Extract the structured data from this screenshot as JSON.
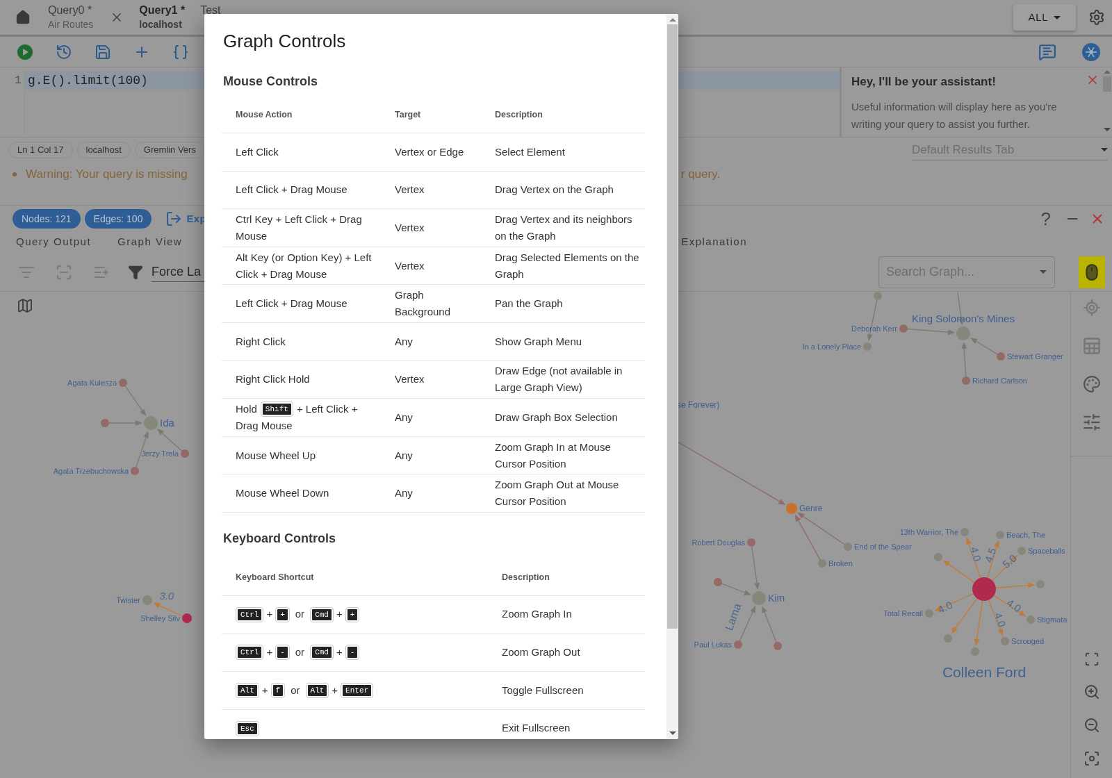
{
  "editor_tabs": [
    {
      "title": "Query0 *",
      "subtitle": "Air Routes",
      "selected": false
    },
    {
      "title": "Query1 *",
      "subtitle": "localhost",
      "selected": true
    },
    {
      "title": "Test",
      "selected": false
    }
  ],
  "scope_button": "ALL",
  "editor": {
    "line_number": "1",
    "code": "g.E().limit(100)"
  },
  "assistant": {
    "title": "Hey, I'll be your assistant!",
    "body": "Useful information will display here as you're writing your query to assist you further."
  },
  "status_chips": [
    "Ln 1 Col 17",
    "localhost",
    "Gremlin Vers"
  ],
  "results_tab_select": "Default Results Tab",
  "warning": {
    "left": "Warning: Your query is missing",
    "right": "r query."
  },
  "result_chips": [
    "Nodes: 121",
    "Edges: 100"
  ],
  "export_label": "Exp",
  "help_mark": "?",
  "result_tabs": [
    {
      "label": "Query Output",
      "selected": false
    },
    {
      "label": "Graph View",
      "selected": false
    },
    {
      "label": "Explanation",
      "selected": false
    }
  ],
  "layout_select": "Force La",
  "search_graph": {
    "placeholder": "Search Graph..."
  },
  "graph": {
    "node_labels": [
      "Agata Kulesza",
      "Ida",
      "Jerzy Trela",
      "Agata Trzebuchowska",
      "Twister",
      "Shelley Silv",
      "In a Lonely Place",
      "Deborah Kerr",
      "King Solomon's Mines",
      "Stewart Granger",
      "Richard Carlson",
      "se Forever)",
      "Genre",
      "Robert Douglas",
      "End of the Spear",
      "Broken",
      "Kim",
      "Paul Lukas",
      "13th Warrior, The",
      "Beach, The",
      "Spaceballs",
      "Colleen Ford",
      "Total Recall",
      "Stigmata",
      "Scrooged"
    ],
    "edge_labels": [
      "3.0",
      "Lama",
      "4.0",
      "4.5",
      "5.0",
      "4.0",
      "4.0",
      "4.0"
    ]
  },
  "dialog": {
    "title": "Graph Controls",
    "mouse_section": {
      "title": "Mouse Controls",
      "columns": [
        "Mouse Action",
        "Target",
        "Description"
      ],
      "rows": [
        {
          "action": [
            {
              "kind": "text",
              "text": "Left Click"
            }
          ],
          "target": "Vertex or Edge",
          "description": "Select Element"
        },
        {
          "action": [
            {
              "kind": "text",
              "text": "Left Click + Drag Mouse"
            }
          ],
          "target": "Vertex",
          "description": "Drag Vertex on the Graph"
        },
        {
          "action": [
            {
              "kind": "text",
              "text": "Ctrl Key + Left Click + Drag Mouse"
            }
          ],
          "target": "Vertex",
          "description": "Drag Vertex and its neighbors on the Graph"
        },
        {
          "action": [
            {
              "kind": "text",
              "text": "Alt Key (or Option Key) + Left Click + Drag Mouse"
            }
          ],
          "target": "Vertex",
          "description": "Drag Selected Elements on the Graph"
        },
        {
          "action": [
            {
              "kind": "text",
              "text": "Left Click + Drag Mouse"
            }
          ],
          "target": "Graph Background",
          "description": "Pan the Graph"
        },
        {
          "action": [
            {
              "kind": "text",
              "text": "Right Click"
            }
          ],
          "target": "Any",
          "description": "Show Graph Menu"
        },
        {
          "action": [
            {
              "kind": "text",
              "text": "Right Click Hold"
            }
          ],
          "target": "Vertex",
          "description": "Draw Edge (not available in Large Graph View)"
        },
        {
          "action": [
            {
              "kind": "text",
              "text": "Hold"
            },
            {
              "kind": "key",
              "text": "Shift"
            },
            {
              "kind": "text",
              "text": "+ Left Click +"
            },
            {
              "kind": "text",
              "text": "Drag Mouse"
            }
          ],
          "target": "Any",
          "description": "Draw Graph Box Selection"
        },
        {
          "action": [
            {
              "kind": "text",
              "text": "Mouse Wheel Up"
            }
          ],
          "target": "Any",
          "description": "Zoom Graph In at Mouse Cursor Position"
        },
        {
          "action": [
            {
              "kind": "text",
              "text": "Mouse Wheel Down"
            }
          ],
          "target": "Any",
          "description": "Zoom Graph Out at Mouse Cursor Position"
        }
      ]
    },
    "keyboard_section": {
      "title": "Keyboard Controls",
      "columns": [
        "Keyboard Shortcut",
        "Description"
      ],
      "rows": [
        {
          "shortcut": [
            {
              "kind": "key",
              "text": "Ctrl"
            },
            {
              "kind": "sep",
              "text": "+"
            },
            {
              "kind": "key",
              "text": "+"
            },
            {
              "kind": "sep",
              "text": "or"
            },
            {
              "kind": "key",
              "text": "Cmd"
            },
            {
              "kind": "sep",
              "text": "+"
            },
            {
              "kind": "key",
              "text": "+"
            }
          ],
          "description": "Zoom Graph In"
        },
        {
          "shortcut": [
            {
              "kind": "key",
              "text": "Ctrl"
            },
            {
              "kind": "sep",
              "text": "+"
            },
            {
              "kind": "key",
              "text": "-"
            },
            {
              "kind": "sep",
              "text": "or"
            },
            {
              "kind": "key",
              "text": "Cmd"
            },
            {
              "kind": "sep",
              "text": "+"
            },
            {
              "kind": "key",
              "text": "-"
            }
          ],
          "description": "Zoom Graph Out"
        },
        {
          "shortcut": [
            {
              "kind": "key",
              "text": "Alt"
            },
            {
              "kind": "sep",
              "text": "+"
            },
            {
              "kind": "key",
              "text": "f"
            },
            {
              "kind": "sep",
              "text": "or"
            },
            {
              "kind": "key",
              "text": "Alt"
            },
            {
              "kind": "sep",
              "text": "+"
            },
            {
              "kind": "key",
              "text": "Enter"
            }
          ],
          "description": "Toggle Fullscreen"
        },
        {
          "shortcut": [
            {
              "kind": "key",
              "text": "Esc"
            }
          ],
          "description": "Exit Fullscreen"
        }
      ]
    }
  }
}
